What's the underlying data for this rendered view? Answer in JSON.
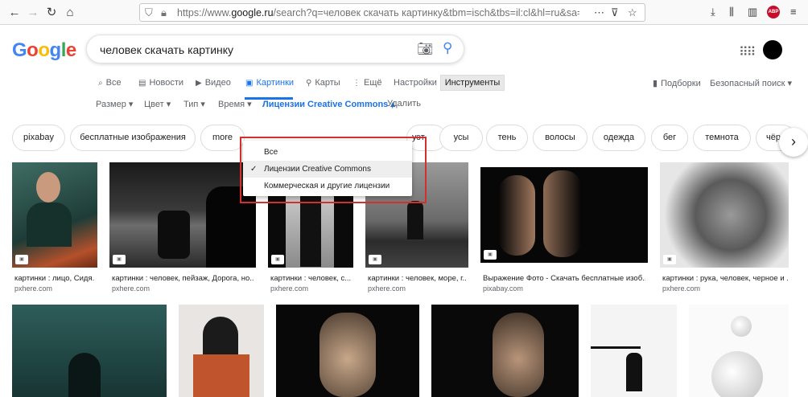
{
  "browser": {
    "url_prefix": "https://www.",
    "url_host": "google.ru",
    "url_rest": "/search?q=человек скачать картинку&tbm=isch&tbs=il:cl&hl=ru&sa=X&ved=0CAAQ1vw",
    "abp_label": "ABP"
  },
  "logo": {
    "g1": "G",
    "o1": "o",
    "o2": "o",
    "g2": "g",
    "l": "l",
    "e": "e"
  },
  "search": {
    "query": "человек скачать картинку"
  },
  "tabs": [
    {
      "label": "Все",
      "icon": "⌕"
    },
    {
      "label": "Новости",
      "icon": "▤"
    },
    {
      "label": "Видео",
      "icon": "▶"
    },
    {
      "label": "Картинки",
      "icon": "▣"
    },
    {
      "label": "Карты",
      "icon": "⚲"
    },
    {
      "label": "Ещё",
      "icon": "⋮"
    },
    {
      "label": "Настройки"
    },
    {
      "label": "Инструменты"
    }
  ],
  "right_links": {
    "collections": "Подборки",
    "safe_search": "Безопасный поиск ▾"
  },
  "filters": [
    {
      "label": "Размер ▾"
    },
    {
      "label": "Цвет ▾"
    },
    {
      "label": "Тип ▾"
    },
    {
      "label": "Время ▾"
    },
    {
      "label": "Лицензии Creative Commons ▴"
    },
    {
      "label": "Удалить"
    }
  ],
  "chips": [
    "pixabay",
    "бесплатные изображения",
    "more",
    "",
    "",
    "уэт",
    "усы",
    "тень",
    "волосы",
    "одежда",
    "бег",
    "темнота",
    "чёр"
  ],
  "dropdown": {
    "items": [
      "Все",
      "Лицензии Creative Commons",
      "Коммерческая и другие лицензии"
    ],
    "selected_index": 1
  },
  "results_row1": [
    {
      "caption": "картинки : лицо, Сидя...",
      "source": "pxhere.com"
    },
    {
      "caption": "картинки : человек, пейзаж, Дорога, но...",
      "source": "pxhere.com"
    },
    {
      "caption": "картинки : человек, с...",
      "source": "pxhere.com"
    },
    {
      "caption": "картинки : человек, море, г...",
      "source": "pxhere.com"
    },
    {
      "caption": "Выражение Фото - Скачать бесплатные изоб...",
      "source": "pixabay.com"
    },
    {
      "caption": "картинки : рука, человек, черное и ...",
      "source": "pxhere.com"
    }
  ],
  "colors": {
    "accent": "#1a73e8",
    "highlight_box": "#d32f2f"
  }
}
